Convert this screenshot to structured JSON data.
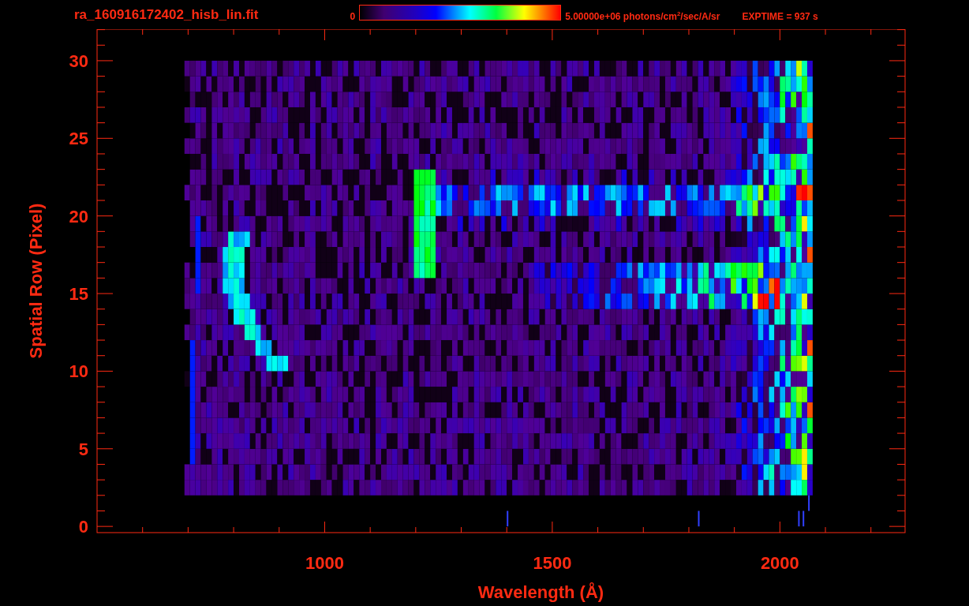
{
  "title": "ra_160916172402_hisb_lin.fit",
  "colorbar": {
    "min_label": "0",
    "max_label": "5.00000e+06 photons/cm$^{2}$/sec/A/sr"
  },
  "exposure": "EXPTIME = 937 s",
  "plot": {
    "xlabel": "Wavelength (Å)",
    "ylabel": "Spatial Row (Pixel)",
    "xticks": [
      "1000",
      "1500",
      "2000"
    ],
    "yticks": [
      "30",
      "25",
      "20",
      "15",
      "10",
      "5",
      "0"
    ]
  }
}
